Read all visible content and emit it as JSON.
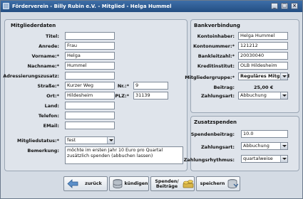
{
  "window": {
    "title": "Förderverein - Billy Rubin e.V. - Mitglied - Helga Hummel",
    "minimize": "_",
    "maximize": "□",
    "close": "×"
  },
  "member": {
    "section_title": "Mitgliederdaten",
    "labels": {
      "title": "Titel:",
      "salutation": "Anrede:",
      "firstname": "Vorname:*",
      "lastname": "Nachname:*",
      "address_extra": "Adressierungszusatz:",
      "street": "Straße:*",
      "number": "Nr.:*",
      "city": "Ort:*",
      "zip": "PLZ:*",
      "country": "Land:",
      "phone": "Telefon:",
      "email": "EMail:",
      "status": "Mitgliedstatus:*",
      "remark": "Bemerkung:"
    },
    "values": {
      "title": "",
      "salutation": "Frau",
      "firstname": "Helga",
      "lastname": "Hummel",
      "address_extra": "",
      "street": "Kurzer Weg",
      "number": "9",
      "city": "Hildesheim",
      "zip": "31139",
      "country": "",
      "phone": "",
      "email": "",
      "status": "fest",
      "remark": "möchte im ersten Jahr 10 Euro pro Quartal zusätzlich spenden (abbuchen lassen)"
    }
  },
  "bank": {
    "section_title": "Bankverbindung",
    "labels": {
      "holder": "Kontoinhaber:",
      "account": "Kontonummer:*",
      "bank_code": "Bankleitzahl:*",
      "institute": "Kreditinstitut:",
      "group": "Mitgliedergruppe:*",
      "fee": "Beitrag:",
      "payment": "Zahlungsart:"
    },
    "values": {
      "holder": "Helga Hummel",
      "account": "121212",
      "bank_code": "20030040",
      "institute": "OLB Hildesheim",
      "group": "Reguläres Mitglied",
      "fee": "25,00 €",
      "payment": "Abbuchung"
    }
  },
  "donations": {
    "section_title": "Zusatzspenden",
    "labels": {
      "amount": "Spendenbeitrag:",
      "payment": "Zahlungsart:",
      "rhythm": "Zahlungsrhythmus:"
    },
    "values": {
      "amount": "10.0",
      "payment": "Abbuchung",
      "rhythm": "quartalweise"
    }
  },
  "buttons": {
    "back": "zurück",
    "cancel": "kündigen",
    "donations_line1": "Spenden/",
    "donations_line2": "Beiträge",
    "save": "speichern"
  }
}
